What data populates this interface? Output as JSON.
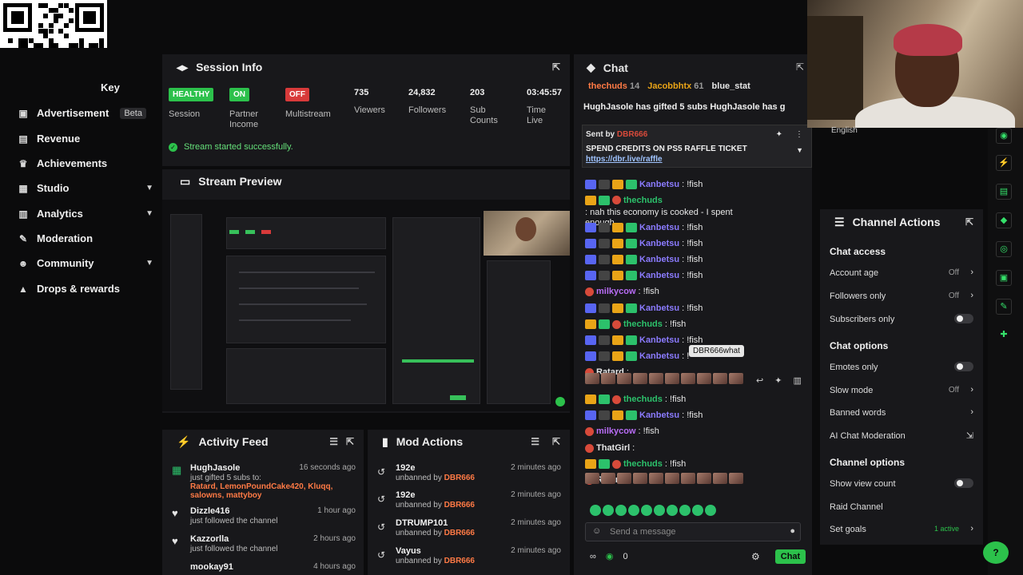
{
  "nav": {
    "items": [
      {
        "label": "Key",
        "icon": "key-icon"
      },
      {
        "label": "Advertisement",
        "icon": "ad-icon",
        "badge": "Beta"
      },
      {
        "label": "Revenue",
        "icon": "revenue-icon"
      },
      {
        "label": "Achievements",
        "icon": "trophy-icon"
      },
      {
        "label": "Studio",
        "icon": "studio-icon"
      },
      {
        "label": "Analytics",
        "icon": "analytics-icon"
      },
      {
        "label": "Moderation",
        "icon": "wrench-icon"
      },
      {
        "label": "Community",
        "icon": "people-icon"
      },
      {
        "label": "Drops & rewards",
        "icon": "gift-icon"
      }
    ]
  },
  "session": {
    "title": "Session Info",
    "stats": [
      {
        "value": "HEALTHY",
        "label": "Session"
      },
      {
        "value": "ON",
        "label": "Partner Income"
      },
      {
        "value": "OFF",
        "label": "Multistream"
      },
      {
        "value": "735",
        "label": "Viewers"
      },
      {
        "value": "24,832",
        "label": "Followers"
      },
      {
        "value": "203",
        "label": "Sub Counts"
      },
      {
        "value": "03:45:57",
        "label": "Time Live"
      }
    ],
    "status": "Stream started successfully."
  },
  "preview": {
    "title": "Stream Preview"
  },
  "activity": {
    "title": "Activity Feed",
    "items": [
      {
        "name": "HughJasole",
        "time": "16 seconds ago",
        "desc": "just gifted 5 subs to:",
        "sub": "Ratard, LemonPoundCake420, Kluqq, salowns, mattyboy"
      },
      {
        "name": "Dizzle416",
        "time": "1 hour ago",
        "desc": "just followed the channel"
      },
      {
        "name": "Kazzorlla",
        "time": "2 hours ago",
        "desc": "just followed the channel"
      },
      {
        "name": "mookay91",
        "time": "4 hours ago",
        "desc": ""
      }
    ]
  },
  "mod": {
    "title": "Mod Actions",
    "items": [
      {
        "name": "192e",
        "time": "2 minutes ago",
        "action": "unbanned by",
        "by": "DBR666"
      },
      {
        "name": "192e",
        "time": "2 minutes ago",
        "action": "unbanned by",
        "by": "DBR666"
      },
      {
        "name": "DTRUMP101",
        "time": "2 minutes ago",
        "action": "unbanned by",
        "by": "DBR666"
      },
      {
        "name": "Vayus",
        "time": "2 minutes ago",
        "action": "unbanned by",
        "by": "DBR666"
      }
    ]
  },
  "chat": {
    "title": "Chat",
    "leaders": [
      {
        "name": "thechuds",
        "count": "14"
      },
      {
        "name": "Jacobbhtx",
        "count": "61"
      },
      {
        "name": "blue_stat",
        "count": ""
      }
    ],
    "gift_bar": "HughJasole has gifted 5 subs   HughJasole has g",
    "pinned": {
      "by": "Sent by",
      "sender": "DBR666",
      "text": "SPEND CREDITS ON PS5 RAFFLE TICKET",
      "link": "https://dbr.live/raffle"
    },
    "messages": [
      {
        "user": "Kanbetsu",
        "color": "#8b7bff",
        "text": ": !fish"
      },
      {
        "user": "thechuds",
        "color": "#2cc16b",
        "text": ": nah this economy is cooked - I spent enough"
      },
      {
        "user": "Kanbetsu",
        "color": "#8b7bff",
        "text": ": !fish"
      },
      {
        "user": "Kanbetsu",
        "color": "#8b7bff",
        "text": ": !fish"
      },
      {
        "user": "Kanbetsu",
        "color": "#8b7bff",
        "text": ": !fish"
      },
      {
        "user": "Kanbetsu",
        "color": "#8b7bff",
        "text": ": !fish"
      },
      {
        "user": "milkycow",
        "color": "#b86cf5",
        "text": ": !fish"
      },
      {
        "user": "Kanbetsu",
        "color": "#8b7bff",
        "text": ": !fish"
      },
      {
        "user": "thechuds",
        "color": "#2cc16b",
        "text": ": !fish"
      },
      {
        "user": "Kanbetsu",
        "color": "#8b7bff",
        "text": ": !fish"
      },
      {
        "user": "Kanbetsu",
        "color": "#8b7bff",
        "text": ": !"
      },
      {
        "user": "Ratard",
        "color": "#e6e6e6",
        "text": ":"
      },
      {
        "user": "thechuds",
        "color": "#2cc16b",
        "text": ": !fish"
      },
      {
        "user": "Kanbetsu",
        "color": "#8b7bff",
        "text": ": !fish"
      },
      {
        "user": "milkycow",
        "color": "#b86cf5",
        "text": ": !fish"
      },
      {
        "user": "ThatGirl",
        "color": "#e6e6e6",
        "text": ":"
      },
      {
        "user": "thechuds",
        "color": "#2cc16b",
        "text": ": !fish"
      },
      {
        "user": "Ratard",
        "color": "#e6e6e6",
        "text": ":"
      }
    ],
    "tooltip": "DBR666what",
    "input_placeholder": "Send a message",
    "points": "0",
    "send_label": "Chat"
  },
  "channel_actions": {
    "title": "Channel Actions",
    "sections": {
      "access": "Chat access",
      "options": "Chat options",
      "channel": "Channel options"
    },
    "rows": {
      "account_age": {
        "label": "Account age",
        "value": "Off"
      },
      "followers_only": {
        "label": "Followers only",
        "value": "Off"
      },
      "subscribers_only": {
        "label": "Subscribers only"
      },
      "emotes_only": {
        "label": "Emotes only"
      },
      "slow_mode": {
        "label": "Slow mode",
        "value": "Off"
      },
      "banned_words": {
        "label": "Banned words"
      },
      "ai_moderation": {
        "label": "AI Chat Moderation"
      },
      "show_view_count": {
        "label": "Show view count"
      },
      "raid_channel": {
        "label": "Raid Channel"
      },
      "set_goals": {
        "label": "Set goals",
        "value": "1 active"
      }
    }
  },
  "camera": {
    "language": "English"
  },
  "colors": {
    "accent": "#2cc14b",
    "danger": "#d83a3a",
    "panel": "#18181b",
    "orange": "#ff7a45"
  }
}
